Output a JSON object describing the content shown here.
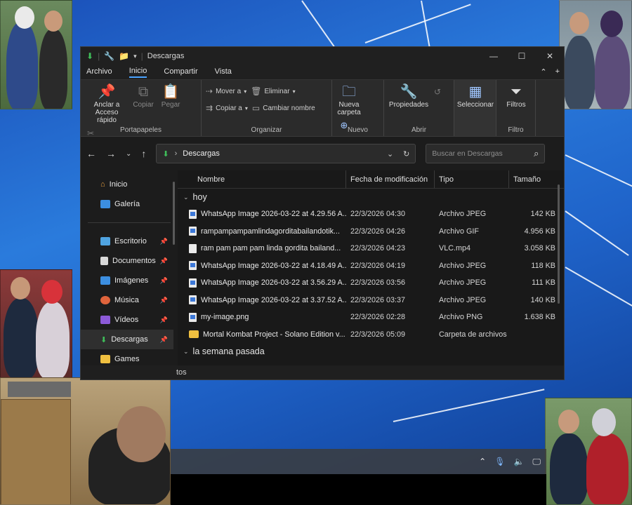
{
  "window": {
    "title": "Descargas",
    "controls": [
      "—",
      "☐",
      "✕"
    ]
  },
  "menu": {
    "tabs": [
      "Archivo",
      "Inicio",
      "Compartir",
      "Vista"
    ],
    "active": "Inicio"
  },
  "ribbon": {
    "portapapeles": {
      "pin_label": "Anclar a Acceso rápido",
      "copy_label": "Copiar",
      "paste_label": "Pegar",
      "group": "Portapapeles"
    },
    "organizar": {
      "move_label": "Mover a",
      "copy_to_label": "Copiar a",
      "delete_label": "Eliminar",
      "rename_label": "Cambiar nombre",
      "group": "Organizar"
    },
    "nuevo": {
      "new_folder_label": "Nueva carpeta",
      "group": "Nuevo"
    },
    "abrir": {
      "properties_label": "Propiedades",
      "group": "Abrir"
    },
    "seleccionar": {
      "select_label": "Seleccionar"
    },
    "filtro": {
      "filters_label": "Filtros",
      "group": "Filtro"
    }
  },
  "address": {
    "path": "Descargas",
    "search_placeholder": "Buscar en Descargas"
  },
  "sidebar": {
    "top": [
      {
        "label": "Inicio",
        "icon": "home-icon"
      },
      {
        "label": "Galería",
        "icon": "gallery-icon"
      }
    ],
    "pinned": [
      {
        "label": "Escritorio",
        "icon": "desktop-icon",
        "color": "#4fa3e0"
      },
      {
        "label": "Documentos",
        "icon": "documents-icon",
        "color": "#d9d9d9"
      },
      {
        "label": "Imágenes",
        "icon": "pictures-icon",
        "color": "#3c8ee0"
      },
      {
        "label": "Música",
        "icon": "music-icon",
        "color": "#e0643c"
      },
      {
        "label": "Vídeos",
        "icon": "videos-icon",
        "color": "#8c5ad8"
      },
      {
        "label": "Descargas",
        "icon": "downloads-icon",
        "color": "#3fbf5a"
      },
      {
        "label": "Games",
        "icon": "folder-icon",
        "color": "#f0c040"
      }
    ]
  },
  "columns": [
    "Nombre",
    "Fecha de modificación",
    "Tipo",
    "Tamaño"
  ],
  "groups": {
    "today": "hoy",
    "last_week": "la semana pasada"
  },
  "files": [
    {
      "name": "WhatsApp Image 2026-03-22 at 4.29.56 A...",
      "date": "22/3/2026 04:30",
      "type": "Archivo JPEG",
      "size": "142 KB",
      "kind": "img"
    },
    {
      "name": "rampampampamlindagorditabailandotik...",
      "date": "22/3/2026 04:26",
      "type": "Archivo GIF",
      "size": "4.956 KB",
      "kind": "img"
    },
    {
      "name": "ram pam pam pam linda gordita bailand...",
      "date": "22/3/2026 04:23",
      "type": "VLC.mp4",
      "size": "3.058 KB",
      "kind": "doc"
    },
    {
      "name": "WhatsApp Image 2026-03-22 at 4.18.49 A...",
      "date": "22/3/2026 04:19",
      "type": "Archivo JPEG",
      "size": "118 KB",
      "kind": "img"
    },
    {
      "name": "WhatsApp Image 2026-03-22 at 3.56.29 A...",
      "date": "22/3/2026 03:56",
      "type": "Archivo JPEG",
      "size": "111 KB",
      "kind": "img"
    },
    {
      "name": "WhatsApp Image 2026-03-22 at 3.37.52 A...",
      "date": "22/3/2026 03:37",
      "type": "Archivo JPEG",
      "size": "140 KB",
      "kind": "img"
    },
    {
      "name": "my-image.png",
      "date": "22/3/2026 02:28",
      "type": "Archivo PNG",
      "size": "1.638 KB",
      "kind": "img"
    },
    {
      "name": "Mortal Kombat Project - Solano Edition v...",
      "date": "22/3/2026 05:09",
      "type": "Carpeta de archivos",
      "size": "",
      "kind": "folder"
    }
  ],
  "status": {
    "text": "tos"
  }
}
